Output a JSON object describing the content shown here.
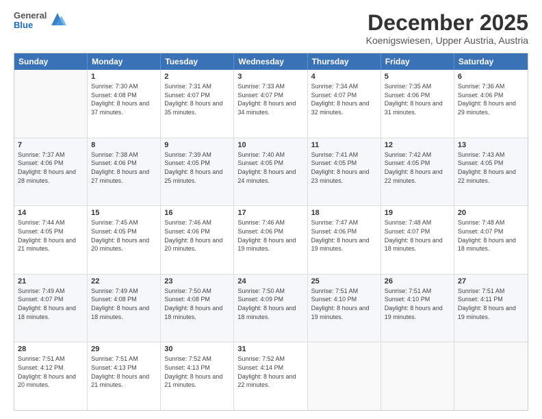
{
  "header": {
    "logo_general": "General",
    "logo_blue": "Blue",
    "month": "December 2025",
    "location": "Koenigswiesen, Upper Austria, Austria"
  },
  "weekdays": [
    "Sunday",
    "Monday",
    "Tuesday",
    "Wednesday",
    "Thursday",
    "Friday",
    "Saturday"
  ],
  "weeks": [
    [
      {
        "day": "",
        "sunrise": "",
        "sunset": "",
        "daylight": ""
      },
      {
        "day": "1",
        "sunrise": "Sunrise: 7:30 AM",
        "sunset": "Sunset: 4:08 PM",
        "daylight": "Daylight: 8 hours and 37 minutes."
      },
      {
        "day": "2",
        "sunrise": "Sunrise: 7:31 AM",
        "sunset": "Sunset: 4:07 PM",
        "daylight": "Daylight: 8 hours and 35 minutes."
      },
      {
        "day": "3",
        "sunrise": "Sunrise: 7:33 AM",
        "sunset": "Sunset: 4:07 PM",
        "daylight": "Daylight: 8 hours and 34 minutes."
      },
      {
        "day": "4",
        "sunrise": "Sunrise: 7:34 AM",
        "sunset": "Sunset: 4:07 PM",
        "daylight": "Daylight: 8 hours and 32 minutes."
      },
      {
        "day": "5",
        "sunrise": "Sunrise: 7:35 AM",
        "sunset": "Sunset: 4:06 PM",
        "daylight": "Daylight: 8 hours and 31 minutes."
      },
      {
        "day": "6",
        "sunrise": "Sunrise: 7:36 AM",
        "sunset": "Sunset: 4:06 PM",
        "daylight": "Daylight: 8 hours and 29 minutes."
      }
    ],
    [
      {
        "day": "7",
        "sunrise": "Sunrise: 7:37 AM",
        "sunset": "Sunset: 4:06 PM",
        "daylight": "Daylight: 8 hours and 28 minutes."
      },
      {
        "day": "8",
        "sunrise": "Sunrise: 7:38 AM",
        "sunset": "Sunset: 4:06 PM",
        "daylight": "Daylight: 8 hours and 27 minutes."
      },
      {
        "day": "9",
        "sunrise": "Sunrise: 7:39 AM",
        "sunset": "Sunset: 4:05 PM",
        "daylight": "Daylight: 8 hours and 25 minutes."
      },
      {
        "day": "10",
        "sunrise": "Sunrise: 7:40 AM",
        "sunset": "Sunset: 4:05 PM",
        "daylight": "Daylight: 8 hours and 24 minutes."
      },
      {
        "day": "11",
        "sunrise": "Sunrise: 7:41 AM",
        "sunset": "Sunset: 4:05 PM",
        "daylight": "Daylight: 8 hours and 23 minutes."
      },
      {
        "day": "12",
        "sunrise": "Sunrise: 7:42 AM",
        "sunset": "Sunset: 4:05 PM",
        "daylight": "Daylight: 8 hours and 22 minutes."
      },
      {
        "day": "13",
        "sunrise": "Sunrise: 7:43 AM",
        "sunset": "Sunset: 4:05 PM",
        "daylight": "Daylight: 8 hours and 22 minutes."
      }
    ],
    [
      {
        "day": "14",
        "sunrise": "Sunrise: 7:44 AM",
        "sunset": "Sunset: 4:05 PM",
        "daylight": "Daylight: 8 hours and 21 minutes."
      },
      {
        "day": "15",
        "sunrise": "Sunrise: 7:45 AM",
        "sunset": "Sunset: 4:05 PM",
        "daylight": "Daylight: 8 hours and 20 minutes."
      },
      {
        "day": "16",
        "sunrise": "Sunrise: 7:46 AM",
        "sunset": "Sunset: 4:06 PM",
        "daylight": "Daylight: 8 hours and 20 minutes."
      },
      {
        "day": "17",
        "sunrise": "Sunrise: 7:46 AM",
        "sunset": "Sunset: 4:06 PM",
        "daylight": "Daylight: 8 hours and 19 minutes."
      },
      {
        "day": "18",
        "sunrise": "Sunrise: 7:47 AM",
        "sunset": "Sunset: 4:06 PM",
        "daylight": "Daylight: 8 hours and 19 minutes."
      },
      {
        "day": "19",
        "sunrise": "Sunrise: 7:48 AM",
        "sunset": "Sunset: 4:07 PM",
        "daylight": "Daylight: 8 hours and 18 minutes."
      },
      {
        "day": "20",
        "sunrise": "Sunrise: 7:48 AM",
        "sunset": "Sunset: 4:07 PM",
        "daylight": "Daylight: 8 hours and 18 minutes."
      }
    ],
    [
      {
        "day": "21",
        "sunrise": "Sunrise: 7:49 AM",
        "sunset": "Sunset: 4:07 PM",
        "daylight": "Daylight: 8 hours and 18 minutes."
      },
      {
        "day": "22",
        "sunrise": "Sunrise: 7:49 AM",
        "sunset": "Sunset: 4:08 PM",
        "daylight": "Daylight: 8 hours and 18 minutes."
      },
      {
        "day": "23",
        "sunrise": "Sunrise: 7:50 AM",
        "sunset": "Sunset: 4:08 PM",
        "daylight": "Daylight: 8 hours and 18 minutes."
      },
      {
        "day": "24",
        "sunrise": "Sunrise: 7:50 AM",
        "sunset": "Sunset: 4:09 PM",
        "daylight": "Daylight: 8 hours and 18 minutes."
      },
      {
        "day": "25",
        "sunrise": "Sunrise: 7:51 AM",
        "sunset": "Sunset: 4:10 PM",
        "daylight": "Daylight: 8 hours and 19 minutes."
      },
      {
        "day": "26",
        "sunrise": "Sunrise: 7:51 AM",
        "sunset": "Sunset: 4:10 PM",
        "daylight": "Daylight: 8 hours and 19 minutes."
      },
      {
        "day": "27",
        "sunrise": "Sunrise: 7:51 AM",
        "sunset": "Sunset: 4:11 PM",
        "daylight": "Daylight: 8 hours and 19 minutes."
      }
    ],
    [
      {
        "day": "28",
        "sunrise": "Sunrise: 7:51 AM",
        "sunset": "Sunset: 4:12 PM",
        "daylight": "Daylight: 8 hours and 20 minutes."
      },
      {
        "day": "29",
        "sunrise": "Sunrise: 7:51 AM",
        "sunset": "Sunset: 4:13 PM",
        "daylight": "Daylight: 8 hours and 21 minutes."
      },
      {
        "day": "30",
        "sunrise": "Sunrise: 7:52 AM",
        "sunset": "Sunset: 4:13 PM",
        "daylight": "Daylight: 8 hours and 21 minutes."
      },
      {
        "day": "31",
        "sunrise": "Sunrise: 7:52 AM",
        "sunset": "Sunset: 4:14 PM",
        "daylight": "Daylight: 8 hours and 22 minutes."
      },
      {
        "day": "",
        "sunrise": "",
        "sunset": "",
        "daylight": ""
      },
      {
        "day": "",
        "sunrise": "",
        "sunset": "",
        "daylight": ""
      },
      {
        "day": "",
        "sunrise": "",
        "sunset": "",
        "daylight": ""
      }
    ]
  ]
}
